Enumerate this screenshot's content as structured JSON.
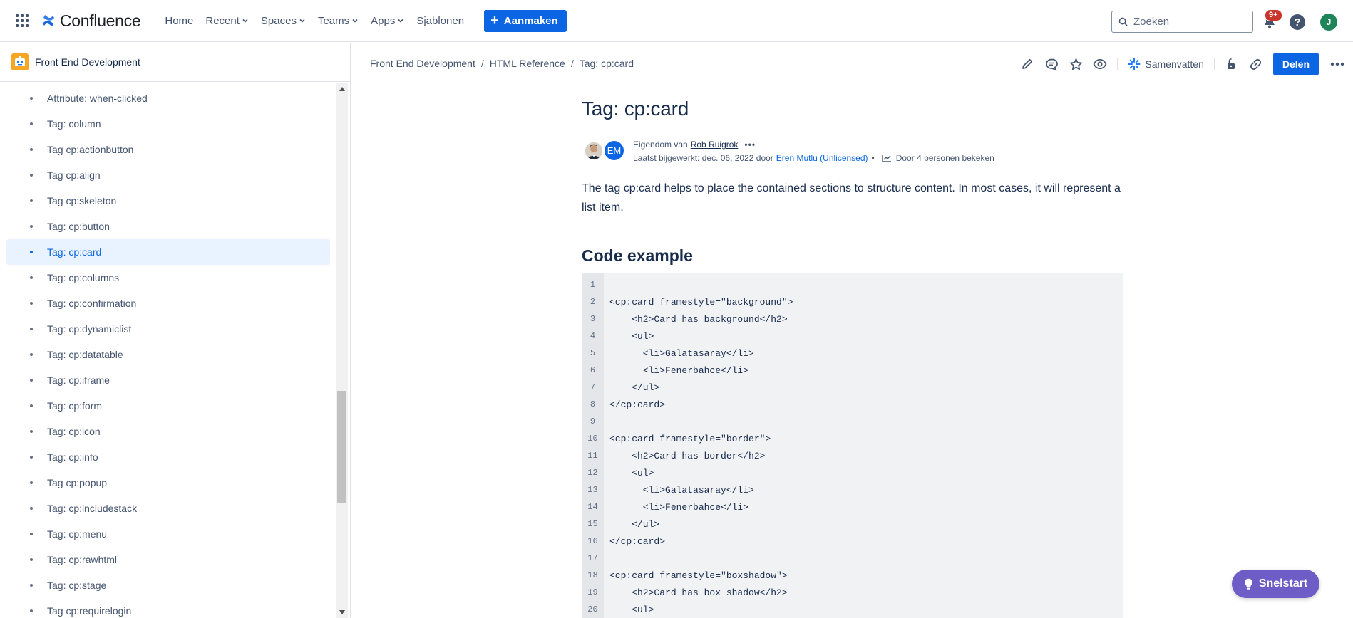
{
  "topnav": {
    "logo_text": "Confluence",
    "items": [
      {
        "label": "Home",
        "has_menu": false
      },
      {
        "label": "Recent",
        "has_menu": true
      },
      {
        "label": "Spaces",
        "has_menu": true
      },
      {
        "label": "Teams",
        "has_menu": true
      },
      {
        "label": "Apps",
        "has_menu": true
      },
      {
        "label": "Sjablonen",
        "has_menu": false
      }
    ],
    "create_label": "Aanmaken",
    "search_placeholder": "Zoeken",
    "notification_badge": "9+",
    "help_label": "?",
    "user_initial": "J"
  },
  "sidebar": {
    "space_name": "Front End Development",
    "items": [
      {
        "label": "Attribute: when-clicked",
        "active": false
      },
      {
        "label": "Tag: column",
        "active": false
      },
      {
        "label": "Tag cp:actionbutton",
        "active": false
      },
      {
        "label": "Tag cp:align",
        "active": false
      },
      {
        "label": "Tag cp:skeleton",
        "active": false
      },
      {
        "label": "Tag: cp:button",
        "active": false
      },
      {
        "label": "Tag: cp:card",
        "active": true
      },
      {
        "label": "Tag: cp:columns",
        "active": false
      },
      {
        "label": "Tag: cp:confirmation",
        "active": false
      },
      {
        "label": "Tag: cp:dynamiclist",
        "active": false
      },
      {
        "label": "Tag: cp:datatable",
        "active": false
      },
      {
        "label": "Tag: cp:iframe",
        "active": false
      },
      {
        "label": "Tag: cp:form",
        "active": false
      },
      {
        "label": "Tag: cp:icon",
        "active": false
      },
      {
        "label": "Tag: cp:info",
        "active": false
      },
      {
        "label": "Tag cp:popup",
        "active": false
      },
      {
        "label": "Tag: cp:includestack",
        "active": false
      },
      {
        "label": "Tag: cp:menu",
        "active": false
      },
      {
        "label": "Tag: cp:rawhtml",
        "active": false
      },
      {
        "label": "Tag: cp:stage",
        "active": false
      },
      {
        "label": "Tag cp:requirelogin",
        "active": false
      }
    ]
  },
  "breadcrumb": [
    "Front End Development",
    "HTML Reference",
    "Tag: cp:card"
  ],
  "page_actions": {
    "summarize_label": "Samenvatten",
    "share_label": "Delen"
  },
  "page": {
    "title": "Tag: cp:card",
    "byline": {
      "owner_prefix": "Eigendom van",
      "owner_name": "Rob Ruigrok",
      "more_label": "•••",
      "updated_prefix": "Laatst bijgewerkt: dec. 06, 2022 door",
      "updated_by": "Eren Mutlu (Unlicensed)",
      "separator": "•",
      "views_label": "Door 4 personen bekeken",
      "avatar2_initials": "EM"
    },
    "intro": "The tag cp:card helps to place the contained sections to structure content. In most cases, it will represent a list item.",
    "section_heading": "Code example",
    "code_lines": [
      {
        "n": "1",
        "text": ""
      },
      {
        "n": "2",
        "text": "<cp:card framestyle=\"background\">"
      },
      {
        "n": "3",
        "text": "    <h2>Card has background</h2>"
      },
      {
        "n": "4",
        "text": "    <ul>"
      },
      {
        "n": "5",
        "text": "      <li>Galatasaray</li>"
      },
      {
        "n": "6",
        "text": "      <li>Fenerbahce</li>"
      },
      {
        "n": "7",
        "text": "    </ul>"
      },
      {
        "n": "8",
        "text": "</cp:card>"
      },
      {
        "n": "9",
        "text": ""
      },
      {
        "n": "10",
        "text": "<cp:card framestyle=\"border\">"
      },
      {
        "n": "11",
        "text": "    <h2>Card has border</h2>"
      },
      {
        "n": "12",
        "text": "    <ul>"
      },
      {
        "n": "13",
        "text": "      <li>Galatasaray</li>"
      },
      {
        "n": "14",
        "text": "      <li>Fenerbahce</li>"
      },
      {
        "n": "15",
        "text": "    </ul>"
      },
      {
        "n": "16",
        "text": "</cp:card>"
      },
      {
        "n": "17",
        "text": ""
      },
      {
        "n": "18",
        "text": "<cp:card framestyle=\"boxshadow\">"
      },
      {
        "n": "19",
        "text": "    <h2>Card has box shadow</h2>"
      },
      {
        "n": "20",
        "text": "    <ul>"
      }
    ]
  },
  "snelstart_label": "Snelstart",
  "colors": {
    "brand_blue": "#0c66e4",
    "active_bg": "#e9f2ff",
    "snelstart_purple": "#6e5dc6",
    "badge_red": "#c9372c",
    "avatar_green": "#1f845a"
  },
  "icons": {
    "app_switcher": "grid-icon",
    "search": "search-icon",
    "notifications": "bell-icon",
    "help": "help-icon",
    "edit": "pencil-icon",
    "comment": "comment-icon",
    "star": "star-icon",
    "watch": "eye-icon",
    "summarize": "sparkle-icon",
    "restrictions": "unlock-icon",
    "link": "link-icon",
    "more": "more-horizontal-icon",
    "snelstart": "lightbulb-icon"
  }
}
